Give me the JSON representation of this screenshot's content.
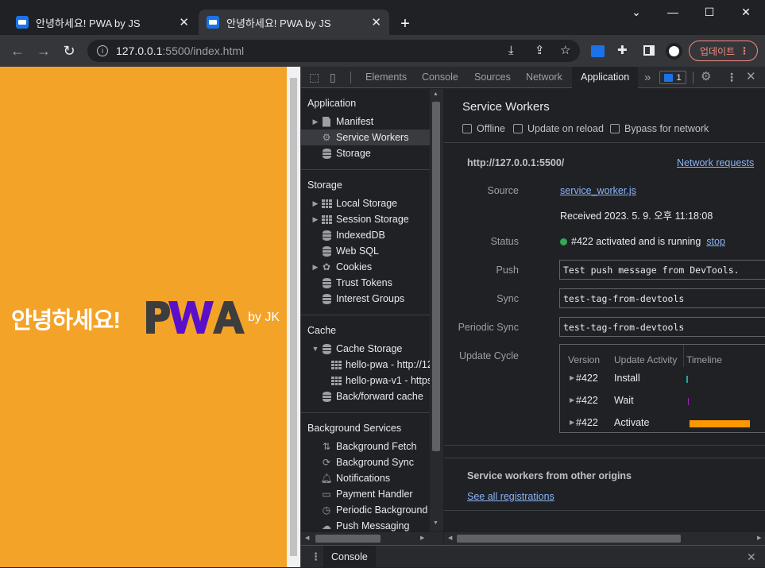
{
  "browser": {
    "tabs": [
      {
        "title": "안녕하세요! PWA by JS"
      },
      {
        "title": "안녕하세요! PWA by JS"
      }
    ],
    "new_tab": "+",
    "window_buttons": {
      "dropdown": "⌄",
      "minimize": "—",
      "maximize": "☐",
      "close": "✕"
    },
    "url_host": "127.0.0.1",
    "url_path": ":5500/index.html",
    "update_button": "업데이트"
  },
  "page": {
    "greeting": "안녕하세요!",
    "logo_text": "PWA",
    "byline": "by JK",
    "brand_color": "#f4a329",
    "logo_color": "#5a0fc8"
  },
  "devtools": {
    "tabs": [
      "Elements",
      "Console",
      "Sources",
      "Network",
      "Application"
    ],
    "active_tab": "Application",
    "more": "»",
    "issues_count": "1",
    "sidebar": {
      "application": {
        "title": "Application",
        "items": [
          "Manifest",
          "Service Workers",
          "Storage"
        ]
      },
      "storage": {
        "title": "Storage",
        "items": [
          "Local Storage",
          "Session Storage",
          "IndexedDB",
          "Web SQL",
          "Cookies",
          "Trust Tokens",
          "Interest Groups"
        ]
      },
      "cache": {
        "title": "Cache",
        "items": [
          "Cache Storage",
          "hello-pwa - http://12",
          "hello-pwa-v1 - https:",
          "Back/forward cache"
        ]
      },
      "background": {
        "title": "Background Services",
        "items": [
          "Background Fetch",
          "Background Sync",
          "Notifications",
          "Payment Handler",
          "Periodic Background S",
          "Push Messaging"
        ]
      }
    },
    "main": {
      "title": "Service Workers",
      "checkboxes": [
        "Offline",
        "Update on reload",
        "Bypass for network"
      ],
      "origin": "http://127.0.0.1:5500/",
      "network_requests": "Network requests",
      "labels": {
        "source": "Source",
        "status": "Status",
        "push": "Push",
        "sync": "Sync",
        "periodic_sync": "Periodic Sync",
        "update_cycle": "Update Cycle"
      },
      "source_file": "service_worker.js",
      "received": "Received 2023. 5. 9. 오후 11:18:08",
      "status_text": "#422 activated and is running",
      "status_color": "#34a853",
      "stop": "stop",
      "push_value": "Test push message from DevTools.",
      "sync_value": "test-tag-from-devtools",
      "periodic_sync_value": "test-tag-from-devtools",
      "update_cycle": {
        "headers": [
          "Version",
          "Update Activity",
          "Timeline"
        ],
        "rows": [
          {
            "version": "#422",
            "activity": "Install",
            "color": "#26a69a"
          },
          {
            "version": "#422",
            "activity": "Wait",
            "color": "#9c27b0"
          },
          {
            "version": "#422",
            "activity": "Activate",
            "color": "#ff9800"
          }
        ]
      },
      "other_origins_title": "Service workers from other origins",
      "see_all": "See all registrations"
    },
    "drawer_tab": "Console"
  }
}
